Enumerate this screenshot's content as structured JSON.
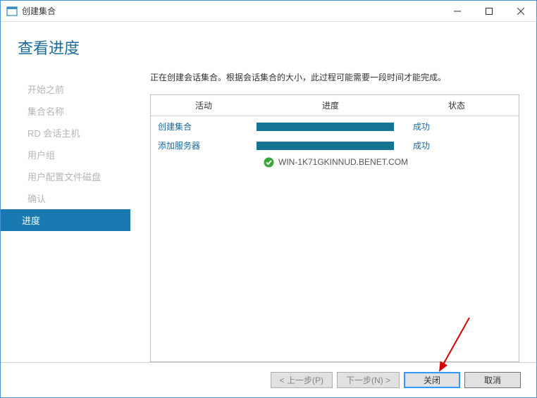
{
  "titlebar": {
    "title": "创建集合"
  },
  "heading": "查看进度",
  "sidebar": {
    "items": [
      {
        "label": "开始之前"
      },
      {
        "label": "集合名称"
      },
      {
        "label": "RD 会话主机"
      },
      {
        "label": "用户组"
      },
      {
        "label": "用户配置文件磁盘"
      },
      {
        "label": "确认"
      },
      {
        "label": "进度"
      }
    ]
  },
  "content": {
    "intro": "正在创建会话集合。根据会话集合的大小，此过程可能需要一段时间才能完成。",
    "headers": {
      "activity": "活动",
      "progress": "进度",
      "status": "状态"
    },
    "rows": [
      {
        "activity": "创建集合",
        "status": "成功"
      },
      {
        "activity": "添加服务器",
        "status": "成功"
      }
    ],
    "server_line": "WIN-1K71GKINNUD.BENET.COM"
  },
  "footer": {
    "prev": "< 上一步(P)",
    "next": "下一步(N) >",
    "close": "关闭",
    "cancel": "取消"
  }
}
